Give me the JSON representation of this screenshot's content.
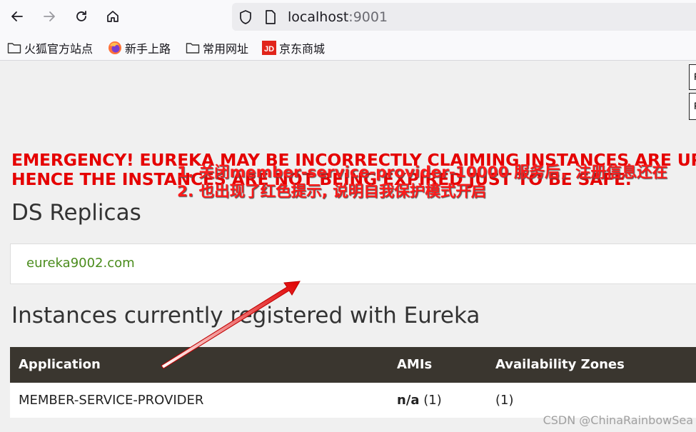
{
  "browser": {
    "url_host": "localhost",
    "url_port": ":9001"
  },
  "bookmarks": [
    {
      "label": "火狐官方站点",
      "icon": "folder-icon"
    },
    {
      "label": "新手上路",
      "icon": "firefox-icon"
    },
    {
      "label": "常用网址",
      "icon": "folder-icon"
    },
    {
      "label": "京东商城",
      "icon": "jd-icon"
    }
  ],
  "page": {
    "side_labels": [
      "F",
      "F"
    ],
    "emergency_line1": "EMERGENCY! EUREKA MAY BE INCORRECTLY CLAIMING INSTANCES ARE UP",
    "emergency_line2": "HENCE THE INSTANCES ARE NOT BEING EXPIRED JUST TO BE SAFE.",
    "replicas_heading": "DS Replicas",
    "replica_link": "eureka9002.com",
    "instances_heading": "Instances currently registered with Eureka",
    "table": {
      "headers": [
        "Application",
        "AMIs",
        "Availability Zones"
      ],
      "rows": [
        {
          "application": "MEMBER-SERVICE-PROVIDER",
          "amis_bold": "n/a",
          "amis_count": " (1)",
          "zones": "(1)"
        }
      ]
    }
  },
  "annotation": {
    "line1": "1. 关闭member-service-provider-10000 服务后，注册信息还在",
    "line2": "2. 也出现了红色提示, 说明自我保护模式开启",
    "color": "#ff1a1a"
  },
  "watermark": "CSDN @ChinaRainbowSea",
  "colors": {
    "emergency": "#e50000",
    "table_header_bg": "#3a362f",
    "replica_link": "#4a8c1c"
  }
}
